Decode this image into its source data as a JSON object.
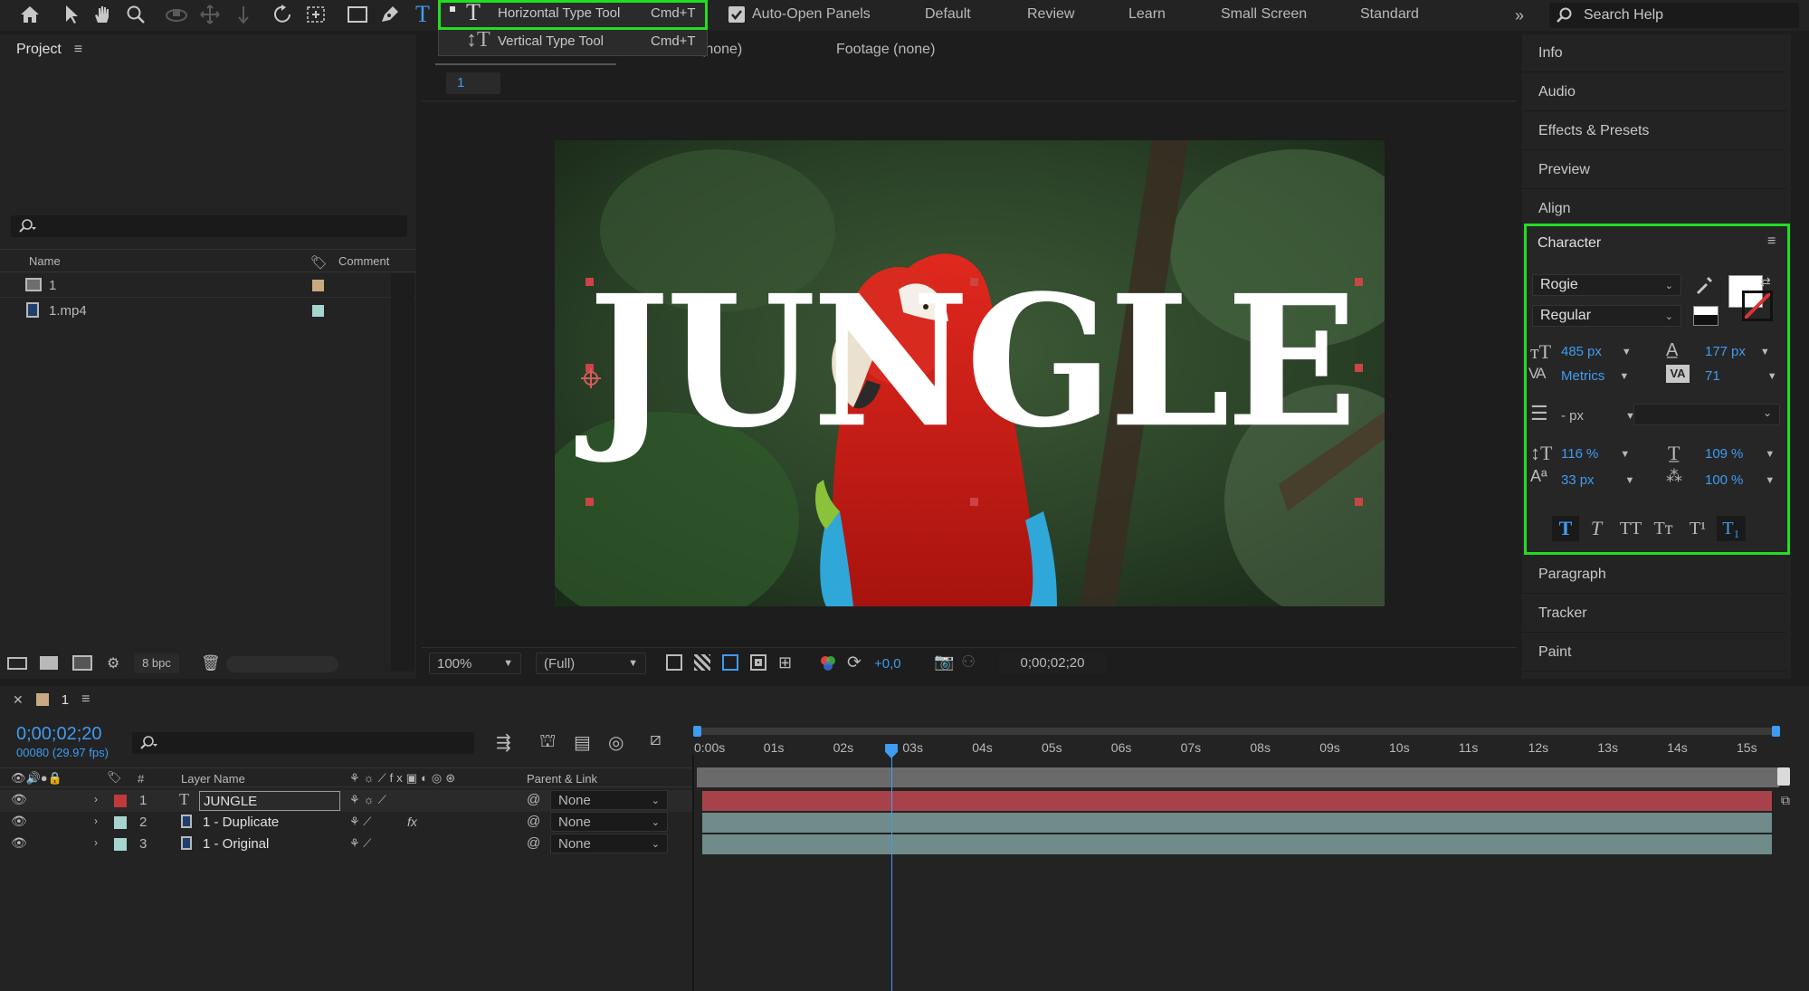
{
  "toolbar": {
    "auto_open_label": "Auto-Open Panels",
    "workspaces": [
      "Default",
      "Review",
      "Learn",
      "Small Screen",
      "Standard"
    ],
    "search_placeholder": "Search Help",
    "icons": [
      "home-icon",
      "selection-arrow-icon",
      "hand-icon",
      "zoom-icon",
      "orbit-camera-icon",
      "pan-behind-icon",
      "move-z-icon",
      "rotate-icon",
      "pan-anchor-icon",
      "rectangle-icon",
      "pen-icon",
      "type-icon"
    ]
  },
  "type_menu": {
    "items": [
      {
        "label": "Horizontal Type Tool",
        "shortcut": "Cmd+T",
        "selected": true
      },
      {
        "label": "Vertical Type Tool",
        "shortcut": "Cmd+T",
        "selected": false
      }
    ]
  },
  "project": {
    "title": "Project",
    "columns": {
      "name": "Name",
      "comment": "Comment"
    },
    "items": [
      {
        "name": "1",
        "type": "composition",
        "label_color": "#c8a982"
      },
      {
        "name": "1.mp4",
        "type": "footage",
        "label_color": "#a8d4d0"
      }
    ],
    "bpc": "8 bpc"
  },
  "viewer": {
    "tabs": [
      "(none)",
      "Footage (none)"
    ],
    "comp_tab": "1",
    "title_text": "JUNGLE",
    "zoom": "100%",
    "resolution": "(Full)",
    "exposure": "+0,0",
    "timecode": "0;00;02;20"
  },
  "right_panels": {
    "top": [
      "Info",
      "Audio",
      "Effects & Presets",
      "Preview",
      "Align"
    ],
    "bottom": [
      "Paragraph",
      "Tracker",
      "Paint"
    ]
  },
  "character": {
    "title": "Character",
    "font": "Rogie",
    "style": "Regular",
    "font_size": "485",
    "font_size_unit": "px",
    "leading": "177",
    "leading_unit": "px",
    "kerning": "Metrics",
    "tracking": "71",
    "stroke_width": "- px",
    "vertical_scale": "116",
    "horizontal_scale": "109",
    "baseline_shift": "33",
    "baseline_unit": "px",
    "tsume": "100",
    "percent": "%",
    "style_buttons": [
      "T",
      "T",
      "TT",
      "Tт",
      "T¹",
      "T₁"
    ]
  },
  "timeline": {
    "comp_name": "1",
    "timecode": "0;00;02;20",
    "frame_info": "00080 (29.97 fps)",
    "headers": {
      "num": "#",
      "layer_name": "Layer Name",
      "parent": "Parent & Link"
    },
    "ruler": [
      "0:00s",
      "01s",
      "02s",
      "03s",
      "04s",
      "05s",
      "06s",
      "07s",
      "08s",
      "09s",
      "10s",
      "11s",
      "12s",
      "13s",
      "14s",
      "15s"
    ],
    "layers": [
      {
        "num": "1",
        "name": "JUNGLE",
        "type": "text",
        "label_color": "#c0393b",
        "parent": "None"
      },
      {
        "num": "2",
        "name": "1 - Duplicate",
        "type": "footage",
        "label_color": "#a8d4d0",
        "parent": "None",
        "fx": "fx"
      },
      {
        "num": "3",
        "name": "1 - Original",
        "type": "footage",
        "label_color": "#a8d4d0",
        "parent": "None"
      }
    ],
    "playhead_seconds": 2.67
  }
}
